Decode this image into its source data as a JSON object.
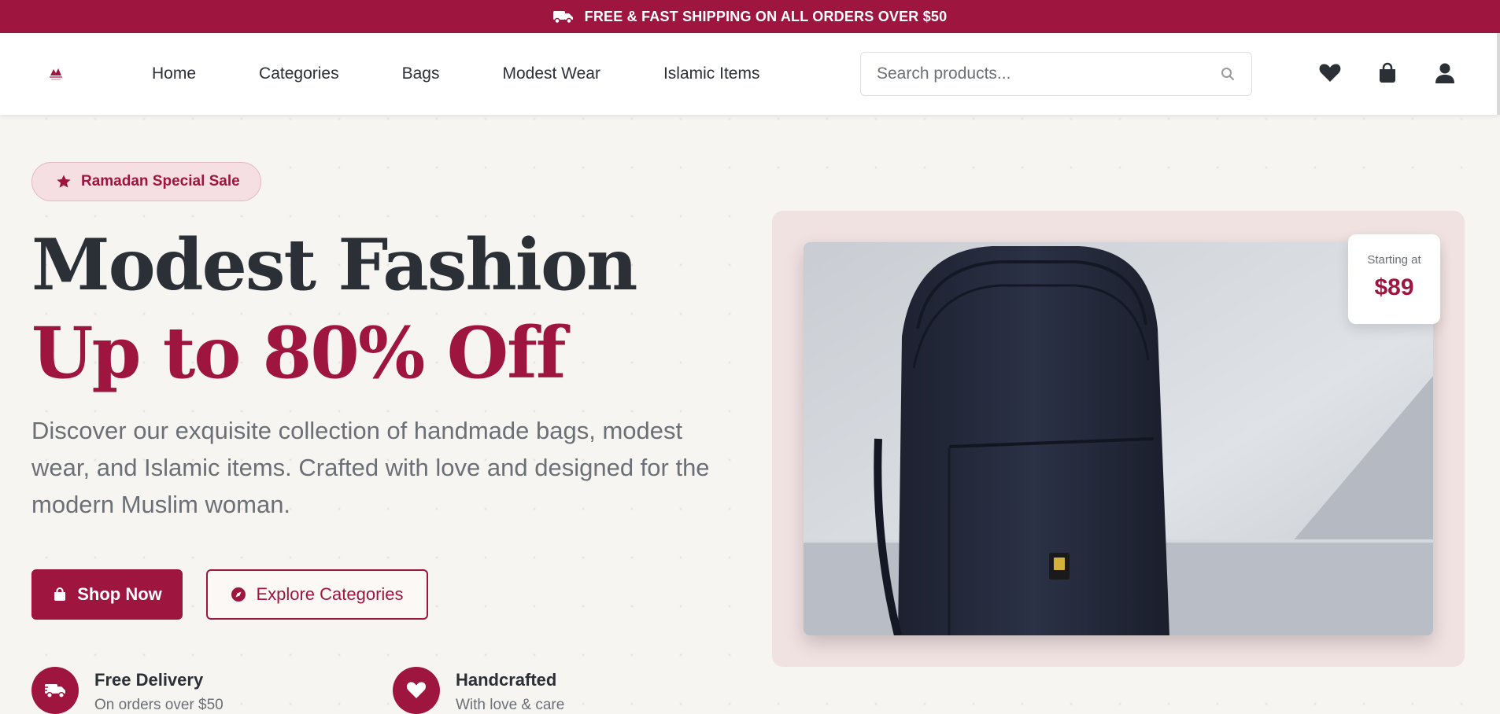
{
  "topbar": {
    "text": "FREE & FAST SHIPPING ON ALL ORDERS OVER $50",
    "icon": "truck-icon"
  },
  "nav": {
    "links": [
      "Home",
      "Categories",
      "Bags",
      "Modest Wear",
      "Islamic Items"
    ],
    "search_placeholder": "Search products...",
    "icons": [
      "heart-icon",
      "shopping-bag-icon",
      "user-icon"
    ]
  },
  "hero": {
    "badge": "Ramadan Special Sale",
    "title_line1": "Modest Fashion",
    "title_line2": "Up to 80% Off",
    "description": "Discover our exquisite collection of handmade bags, modest wear, and Islamic items. Crafted with love and designed for the modern Muslim woman.",
    "shop_now": "Shop Now",
    "explore": "Explore Categories",
    "price_label": "Starting at",
    "price_value": "$89"
  },
  "features": [
    {
      "title": "Free Delivery",
      "subtitle": "On orders over $50",
      "icon": "truck-icon"
    },
    {
      "title": "Handcrafted",
      "subtitle": "With love & care",
      "icon": "heart-icon"
    }
  ],
  "colors": {
    "brand": "#9e1640",
    "text": "#2b2f36",
    "muted": "#6b6f76",
    "background": "#f7f5f2"
  }
}
